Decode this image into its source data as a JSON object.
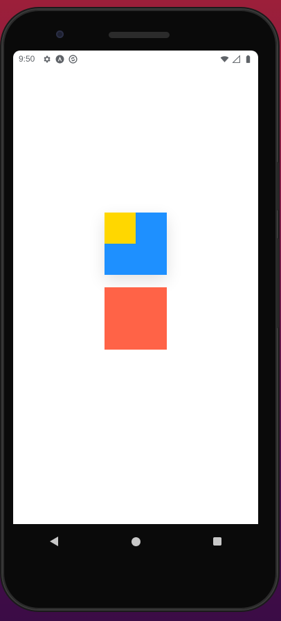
{
  "status_bar": {
    "time": "9:50",
    "left_icons": [
      "settings-icon",
      "app-logo-icon",
      "sync-icon"
    ],
    "right_icons": [
      "wifi-icon",
      "cell-signal-icon",
      "battery-icon"
    ]
  },
  "canvas": {
    "boxes": [
      {
        "name": "blue-box",
        "color": "#1e90ff"
      },
      {
        "name": "yellow-box",
        "color": "#ffd700"
      },
      {
        "name": "red-box",
        "color": "#ff6347"
      }
    ]
  },
  "nav_bar": {
    "buttons": [
      "back-button",
      "home-button",
      "recents-button"
    ]
  },
  "colors": {
    "wallpaper_top": "#9c1f3a",
    "wallpaper_bottom": "#3b0c46",
    "screen_background": "#ffffff",
    "status_text": "#5f6368",
    "nav_icon": "#c8c8c8"
  }
}
